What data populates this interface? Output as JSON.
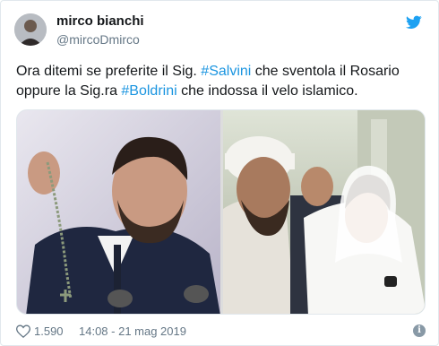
{
  "user": {
    "display_name": "mirco bianchi",
    "handle": "@mircoDmirco"
  },
  "tweet": {
    "text_before": "Ora ditemi se preferite il Sig. ",
    "hashtag_1": "#Salvini",
    "text_middle": " che sventola il Rosario oppure la Sig.ra ",
    "hashtag_2": "#Boldrini",
    "text_after": " che indossa il velo islamico."
  },
  "footer": {
    "like_count": "1.590",
    "timestamp": "14:08 - 21 mag 2019",
    "info_glyph": "i"
  },
  "icons": {
    "brand": "twitter-bird-icon",
    "like": "heart-icon",
    "info": "info-icon"
  },
  "colors": {
    "accent": "#1da1f2",
    "hashtag": "#1b95e0",
    "muted": "#657786"
  }
}
